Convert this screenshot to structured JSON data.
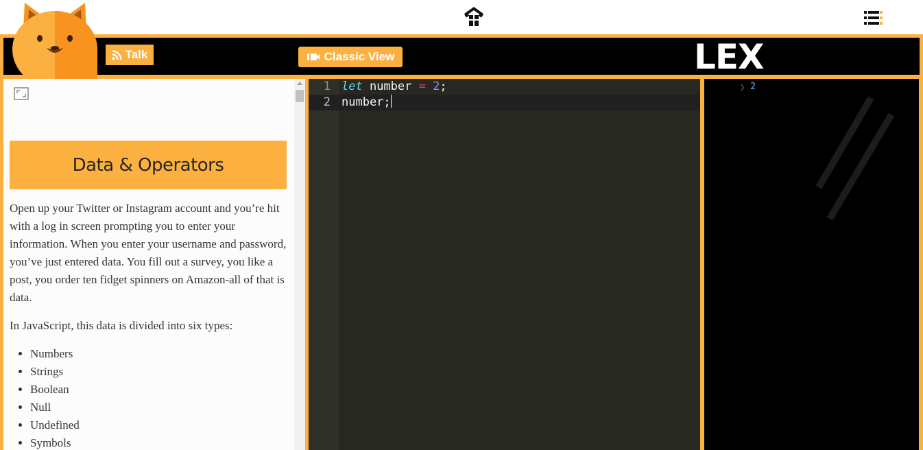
{
  "topbar": {
    "home_icon": "home-icon",
    "menu_icon": "menu-list-icon"
  },
  "header": {
    "talk_label": "Talk",
    "talk_icon": "rss-icon",
    "classic_view_label": "Classic View",
    "classic_view_icon": "video-icon",
    "logo_text": "LEX",
    "mascot": "fox-mascot"
  },
  "lesson": {
    "title": "Data & Operators",
    "paragraphs": [
      "Open up your Twitter or Instagram account and you’re hit with a log in screen prompting you to enter your information. When you enter your username and password, you’ve just entered data. You fill out a survey, you like a post, you order ten fidget spinners on Amazon-all of that is data.",
      "In JavaScript, this data is divided into six types:"
    ],
    "list": [
      "Numbers",
      "Strings",
      "Boolean",
      "Null",
      "Undefined",
      "Symbols"
    ]
  },
  "editor": {
    "lines": [
      {
        "num": "1",
        "kw": "let",
        "name": " number ",
        "op": "=",
        "val": "2",
        "end": ";"
      },
      {
        "num": "2",
        "text": "number;"
      }
    ]
  },
  "console": {
    "output": "2"
  },
  "colors": {
    "accent": "#fbb040",
    "editor_bg": "#272822",
    "console_bg": "#000000"
  }
}
